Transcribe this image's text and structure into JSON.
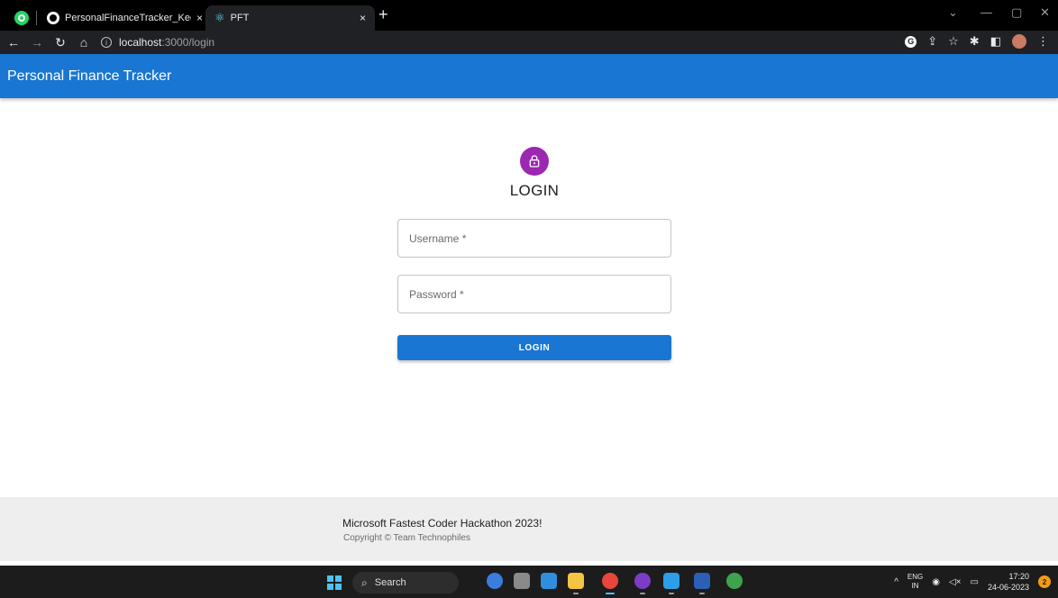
{
  "browser": {
    "tabs": [
      {
        "title": "PersonalFinanceTracker_Keerthar",
        "close": "×"
      },
      {
        "title": "PFT",
        "close": "×"
      }
    ],
    "new_tab": "+",
    "url_host": "localhost",
    "url_path": ":3000/login"
  },
  "app": {
    "title": "Personal Finance Tracker"
  },
  "login": {
    "heading": "LOGIN",
    "username_placeholder": "Username *",
    "password_placeholder": "Password *",
    "button_label": "LOGIN"
  },
  "footer": {
    "title": "Microsoft Fastest Coder Hackathon 2023!",
    "copyright": "Copyright © Team Technophiles"
  },
  "taskbar": {
    "search_label": "Search",
    "lang_line1": "ENG",
    "lang_line2": "IN",
    "time": "17:20",
    "date": "24-06-2023",
    "notification_count": "2"
  },
  "colors": {
    "appbar": "#1976d2",
    "avatar": "#9c27b0",
    "button": "#1976d2",
    "footer": "#eeeeee"
  }
}
